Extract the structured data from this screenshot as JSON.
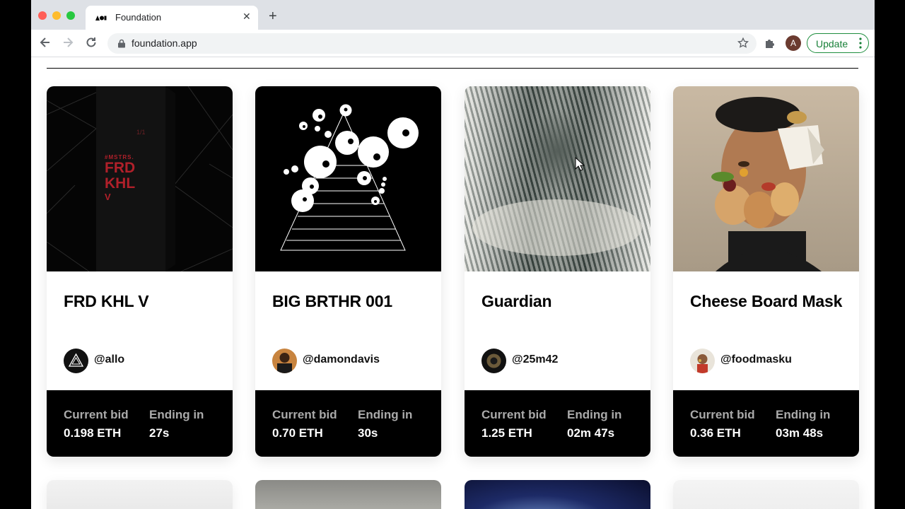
{
  "browser": {
    "tab_title": "Foundation",
    "url": "foundation.app",
    "profile_initial": "A",
    "update_label": "Update"
  },
  "cards": [
    {
      "title": "FRD KHL V",
      "handle": "@allo",
      "bid_label": "Current bid",
      "bid": "0.198 ETH",
      "end_label": "Ending in",
      "ending": "27s"
    },
    {
      "title": "BIG BRTHR 001",
      "handle": "@damondavis",
      "bid_label": "Current bid",
      "bid": "0.70 ETH",
      "end_label": "Ending in",
      "ending": "30s"
    },
    {
      "title": "Guardian",
      "handle": "@25m42",
      "bid_label": "Current bid",
      "bid": "1.25 ETH",
      "end_label": "Ending in",
      "ending": "02m  47s"
    },
    {
      "title": "Cheese Board Mask",
      "handle": "@foodmasku",
      "bid_label": "Current bid",
      "bid": "0.36 ETH",
      "end_label": "Ending in",
      "ending": "03m  48s"
    }
  ],
  "art": {
    "card1_logo_lines": [
      "#MSTRS.",
      "FRD",
      "KHL",
      "V"
    ],
    "card1_edition": "1/1"
  },
  "colors": {
    "tabstrip": "#dee1e6",
    "update_green": "#188038",
    "bid_bar": "#000000"
  },
  "icons": [
    "back-arrow-icon",
    "forward-arrow-icon",
    "reload-icon",
    "lock-icon",
    "star-icon",
    "puzzle-extension-icon",
    "kebab-menu-icon",
    "close-icon",
    "plus-icon"
  ]
}
